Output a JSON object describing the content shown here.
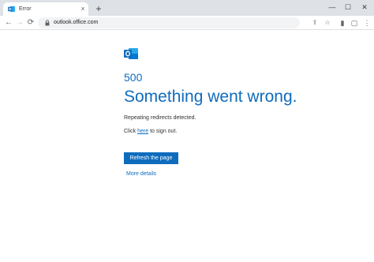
{
  "tab": {
    "title": "Error",
    "close_glyph": "×"
  },
  "new_tab_glyph": "+",
  "window_controls": {
    "minimize": "—",
    "maximize": "☐",
    "close": "✕"
  },
  "toolbar": {
    "back": "←",
    "forward": "→",
    "reload": "⟳",
    "url": "outlook.office.com",
    "share": "⇪",
    "bookmark": "☆",
    "sidepanel": "▮",
    "profile": "▢",
    "menu": "⋮"
  },
  "page": {
    "code": "500",
    "headline": "Something went wrong.",
    "message": "Repeating redirects detected.",
    "signout_prefix": "Click ",
    "signout_link": "here",
    "signout_suffix": " to sign out.",
    "refresh_label": "Refresh the page",
    "more_details": "More details"
  },
  "colors": {
    "accent": "#0f6cbd",
    "tabstrip": "#dee1e6",
    "text": "#323130"
  },
  "icons": {
    "favicon": "outlook-icon",
    "lock": "lock-icon"
  }
}
